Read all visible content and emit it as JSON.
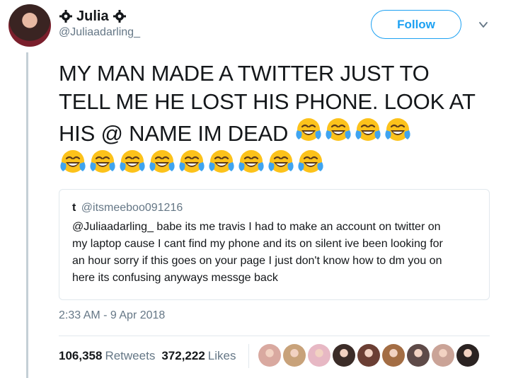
{
  "author": {
    "name": "Julia",
    "handle": "@Juliaadarling_",
    "avatar_icon": "profile-photo-avatar",
    "name_decoration_icon": "gear-icon"
  },
  "actions": {
    "follow_label": "Follow",
    "menu_icon": "chevron-down-icon"
  },
  "tweet": {
    "text": "MY MAN MADE A TWITTER JUST TO TELL ME HE LOST HIS PHONE. LOOK AT HIS @ NAME IM DEAD",
    "emoji_icon": "face-with-tears-of-joy-icon",
    "emoji_count_inline": 4,
    "emoji_count_second_row": 9
  },
  "quoted_tweet": {
    "name": "t",
    "handle": "@itsmeeboo091216",
    "text": "@Juliaadarling_  babe its me travis I had to make an account on twitter on\nmy laptop cause I cant find my phone and its on silent ive been looking for\nan hour sorry if this goes on your page I just don't know how to dm you on\nhere its confusing anyways messge back"
  },
  "timestamp": "2:33 AM - 9 Apr 2018",
  "stats": {
    "retweets_count": "106,358",
    "retweets_label": "Retweets",
    "likes_count": "372,222",
    "likes_label": "Likes"
  },
  "likers": {
    "count": 9,
    "colors": [
      "#d9a9a0",
      "#c8a27a",
      "#e7b8c4",
      "#3b2c28",
      "#6b3f34",
      "#a36d44",
      "#5e4a48",
      "#caa397",
      "#2b2322"
    ]
  },
  "colors": {
    "accent": "#1da1f2",
    "secondary_text": "#657786",
    "primary_text": "#14171a",
    "border": "#e1e8ed"
  }
}
